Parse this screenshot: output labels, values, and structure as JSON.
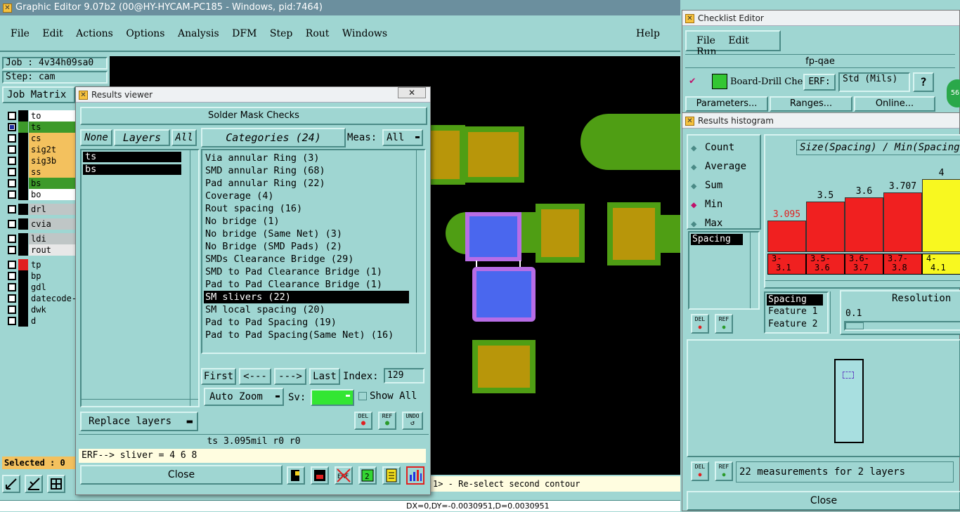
{
  "main": {
    "title": "Graphic Editor 9.07b2 (00@HY-HYCAM-PC185 - Windows, pid:7464)",
    "menu": [
      "File",
      "Edit",
      "Actions",
      "Options",
      "Analysis",
      "DFM",
      "Step",
      "Rout",
      "Windows"
    ],
    "help": "Help",
    "job": "Job : 4v34h09sa0",
    "step": "Step: cam",
    "job_matrix": "Job Matrix",
    "layers": [
      {
        "name": "to",
        "color": "#000000",
        "bg": "#ffffff",
        "checked": false
      },
      {
        "name": "ts",
        "color": "#3d9a2a",
        "bg": "#3d9a2a",
        "checked": true
      },
      {
        "name": "cs",
        "color": "#000000",
        "bg": "#f3c15e",
        "checked": false
      },
      {
        "name": "sig2t",
        "color": "#000000",
        "bg": "#f3c15e",
        "checked": false
      },
      {
        "name": "sig3b",
        "color": "#000000",
        "bg": "#f3c15e",
        "checked": false
      },
      {
        "name": "ss",
        "color": "#000000",
        "bg": "#f3c15e",
        "checked": false
      },
      {
        "name": "bs",
        "color": "#000000",
        "bg": "#3d9a2a",
        "checked": false
      },
      {
        "name": "bo",
        "color": "#000000",
        "bg": "#ffffff",
        "checked": false
      },
      {
        "name": "drl",
        "color": "#000000",
        "bg": "#bfc6c6",
        "checked": false
      },
      {
        "name": "cvia",
        "color": "#000000",
        "bg": "#bfc6c6",
        "checked": false
      },
      {
        "name": "ldi",
        "color": "#000000",
        "bg": "#bfc6c6",
        "checked": false
      },
      {
        "name": "rout",
        "color": "#000000",
        "bg": "#e8e8e8",
        "checked": false
      },
      {
        "name": "tp",
        "color": "#e02020",
        "bg": "#9fd6d2",
        "checked": false
      },
      {
        "name": "bp",
        "color": "#000000",
        "bg": "#9fd6d2",
        "checked": false
      },
      {
        "name": "gdl",
        "color": "#000000",
        "bg": "#9fd6d2",
        "checked": false
      },
      {
        "name": "datecode-",
        "color": "#000000",
        "bg": "#9fd6d2",
        "checked": false
      },
      {
        "name": "dwk",
        "color": "#000000",
        "bg": "#9fd6d2",
        "checked": false
      },
      {
        "name": "d",
        "color": "#000000",
        "bg": "#9fd6d2",
        "checked": false
      }
    ],
    "selected": "Selected : 0",
    "status_msg": "1> - Re-select second contour",
    "coords": "DX=0,DY=-0.0030951,D=0.0030951"
  },
  "results_viewer": {
    "title": "Results viewer",
    "header": "Solder Mask Checks",
    "none": "None",
    "layers": "Layers",
    "all": "All",
    "layer_list": [
      "ts",
      "bs"
    ],
    "categories": "Categories (24)",
    "meas_label": "Meas:",
    "meas_value": "All",
    "items": [
      "Via annular Ring (3)",
      "SMD annular Ring (68)",
      "Pad annular Ring (22)",
      "Coverage (4)",
      "Rout spacing (16)",
      "No bridge (1)",
      "No bridge (Same Net) (3)",
      "No Bridge (SMD Pads) (2)",
      "SMDs Clearance Bridge (29)",
      "SMD to Pad Clearance Bridge (1)",
      "Pad to Pad Clearance Bridge (1)",
      "SM slivers (22)",
      "SM local spacing (20)",
      "Pad to Pad Spacing (19)",
      "Pad to Pad Spacing(Same Net) (16)"
    ],
    "selected_item": 11,
    "first": "First",
    "prev": "<---",
    "next": "--->",
    "last": "Last",
    "index_label": "Index:",
    "index_value": "129",
    "auto_zoom": "Auto Zoom",
    "sv": "Sv:",
    "show_all": "Show All",
    "replace_layers": "Replace layers",
    "del": "DEL",
    "ref": "REF",
    "undo": "UNDO",
    "status": "ts 3.095mil  r0  r0",
    "erf": "ERF--> sliver = 4 6 8",
    "close": "Close"
  },
  "checklist": {
    "title": "Checklist Editor",
    "menu": [
      "File",
      "Edit",
      "Run"
    ],
    "name": "fp-qae",
    "action": "Board-Drill Che",
    "erf": "ERF:",
    "units": "Std (Mils)",
    "help": "?",
    "parameters": "Parameters...",
    "ranges": "Ranges...",
    "online": "Online...",
    "badge": "56"
  },
  "histogram": {
    "title": "Results histogram",
    "modes": [
      "Count",
      "Average",
      "Sum",
      "Min",
      "Max"
    ],
    "selected_mode": "Min",
    "list_item": "Spacing",
    "chart_title": "Size(Spacing) / Min(Spacing)",
    "chart_data": {
      "type": "bar",
      "categories": [
        "3-3.1",
        "3.5-3.6",
        "3.6-3.7",
        "3.7-3.8",
        "4-4.1"
      ],
      "values": [
        3.095,
        3.5,
        3.6,
        3.707,
        4
      ],
      "value_labels": [
        "3.095",
        "3.5",
        "3.6",
        "3.707",
        "4"
      ],
      "colors": [
        "#f02020",
        "#f02020",
        "#f02020",
        "#f02020",
        "#f8f820"
      ],
      "ylim": [
        0,
        4
      ]
    },
    "cat_labels": [
      [
        "3-",
        "3.1"
      ],
      [
        "3.5-",
        "3.6"
      ],
      [
        "3.6-",
        "3.7"
      ],
      [
        "3.7-",
        "3.8"
      ],
      [
        "4-",
        "4.1"
      ]
    ],
    "fields": [
      "Spacing",
      "Feature 1",
      "Feature 2"
    ],
    "resolution_label": "Resolution",
    "resolution_value": "0.1",
    "measurements": "22 measurements for 2 layers",
    "close": "Close"
  }
}
